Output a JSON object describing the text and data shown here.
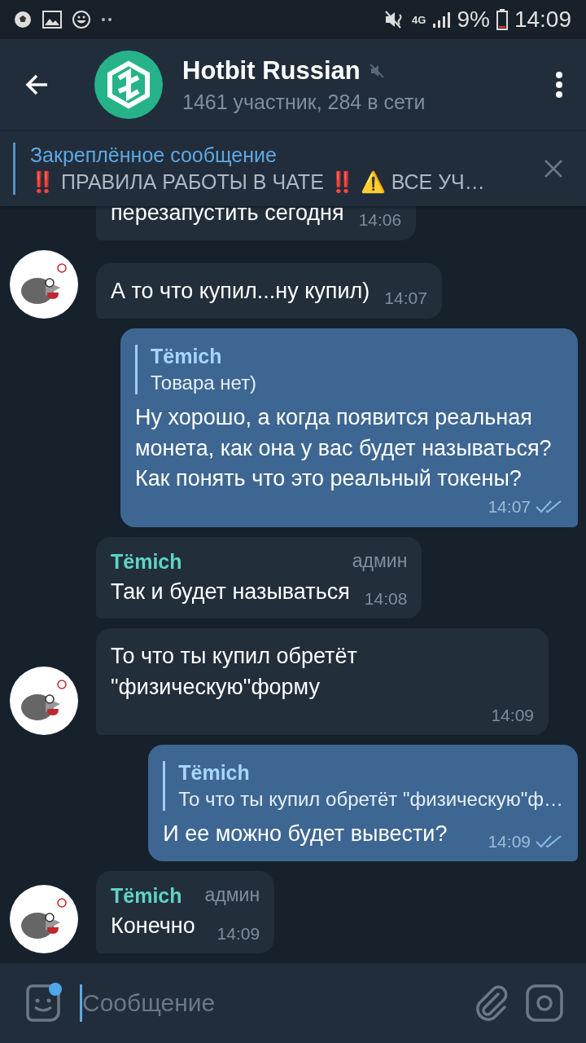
{
  "status_bar": {
    "network": "4G",
    "battery": "9%",
    "time": "14:09"
  },
  "header": {
    "title": "Hotbit Russian",
    "muted": true,
    "subtitle": "1461 участник, 284 в сети"
  },
  "pinned": {
    "title": "Закреплённое сообщение",
    "text": "‼️ ПРАВИЛА РАБОТЫ В ЧАТЕ ‼️ ⚠️ ВСЕ УЧ…"
  },
  "messages": [
    {
      "kind": "incoming",
      "avatar": false,
      "text": "перезапустить сегодня",
      "time": "14:06"
    },
    {
      "kind": "incoming",
      "avatar": true,
      "text": "А то что купил...ну купил)",
      "time": "14:07"
    },
    {
      "kind": "outgoing",
      "reply": {
        "name": "Тёmich",
        "text": "Товара нет)"
      },
      "text": "Ну хорошо, а когда появится реальная монета, как она у вас будет называться? Как понять что это реальный токены?",
      "time": "14:07",
      "read": true
    },
    {
      "kind": "incoming",
      "avatar": false,
      "sender": "Тёmich",
      "badge": "админ",
      "text": "Так и будет называться",
      "time": "14:08"
    },
    {
      "kind": "incoming",
      "avatar": true,
      "text": "То что ты купил обретёт \"физическую\"форму",
      "time": "14:09"
    },
    {
      "kind": "outgoing",
      "reply": {
        "name": "Тёmich",
        "text": "То что ты купил обретёт \"физическую\"ф…"
      },
      "text": "И ее можно будет вывести?",
      "time": "14:09",
      "read": true
    },
    {
      "kind": "incoming",
      "avatar": true,
      "sender": "Тёmich",
      "badge": "админ",
      "text": "Конечно",
      "time": "14:09"
    }
  ],
  "composer": {
    "placeholder": "Сообщение"
  }
}
